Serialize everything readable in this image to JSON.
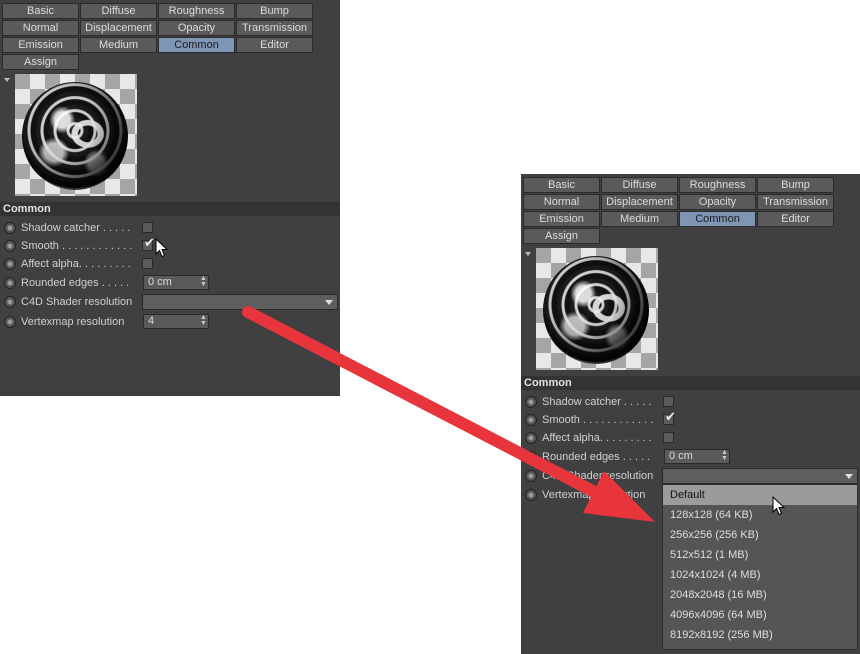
{
  "tabs": [
    "Basic",
    "Diffuse",
    "Roughness",
    "Bump",
    "Normal",
    "Displacement",
    "Opacity",
    "Transmission",
    "Emission",
    "Medium",
    "Common",
    "Editor",
    "Assign"
  ],
  "active_tab": "Common",
  "section_title": "Common",
  "params": {
    "shadow_catcher": "Shadow catcher . . . . .",
    "smooth": "Smooth . . . . . . . . . . . .",
    "affect_alpha": "Affect alpha. . . . . . . . .",
    "rounded_edges": "Rounded edges . . . . .",
    "rounded_edges_value": "0 cm",
    "shader_resolution": "C4D Shader resolution",
    "vertexmap_resolution": "Vertexmap resolution",
    "vertexmap_value": "4"
  },
  "check_glyph": "✔",
  "spin_glyph": "▲▼",
  "dropdown_options": [
    "Default",
    "128x128 (64 KB)",
    "256x256 (256 KB)",
    "512x512 (1 MB)",
    "1024x1024 (4 MB)",
    "2048x2048 (16 MB)",
    "4096x4096 (64 MB)",
    "8192x8192 (256 MB)"
  ],
  "selected_option": "Default",
  "colors": {
    "panel": "#404040",
    "tab": "#5a5a5a",
    "tab_active": "#7f95b5",
    "arrow": "#e8343b"
  }
}
